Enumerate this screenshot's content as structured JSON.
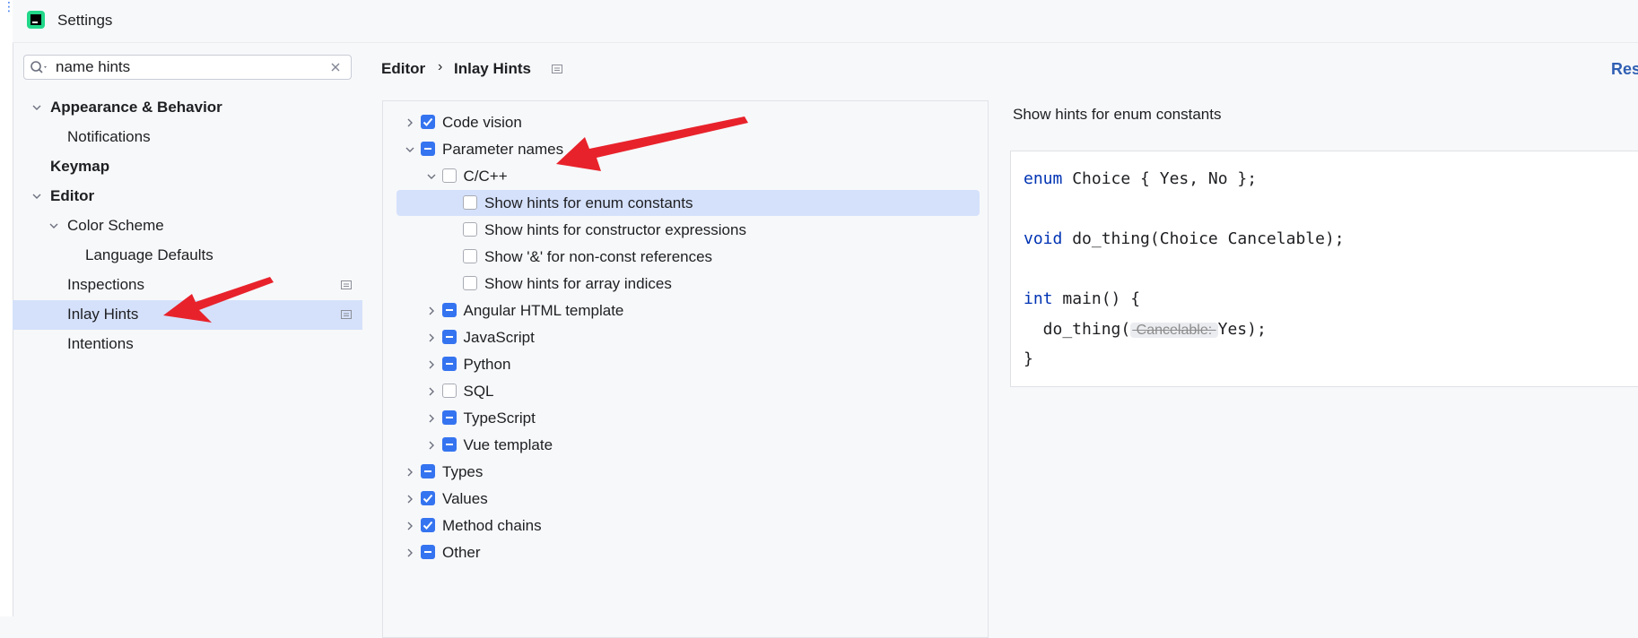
{
  "window": {
    "title": "Settings"
  },
  "search": {
    "value": "name hints",
    "placeholder": ""
  },
  "sidebar": {
    "items": [
      {
        "label": "Appearance & Behavior"
      },
      {
        "label": "Notifications"
      },
      {
        "label": "Keymap"
      },
      {
        "label": "Editor"
      },
      {
        "label": "Color Scheme"
      },
      {
        "label": "Language Defaults"
      },
      {
        "label": "Inspections"
      },
      {
        "label": "Inlay Hints"
      },
      {
        "label": "Intentions"
      }
    ]
  },
  "breadcrumb": {
    "parent": "Editor",
    "separator": "›",
    "current": "Inlay Hints"
  },
  "header": {
    "reset_label": "Res"
  },
  "options": {
    "items": [
      {
        "label": "Code vision",
        "state": "checked"
      },
      {
        "label": "Parameter names",
        "state": "partial"
      },
      {
        "label": "C/C++",
        "state": "unchecked"
      },
      {
        "label": "Show hints for enum constants",
        "state": "unchecked"
      },
      {
        "label": "Show hints for constructor expressions",
        "state": "unchecked"
      },
      {
        "label": "Show '&' for non-const references",
        "state": "unchecked"
      },
      {
        "label": "Show hints for array indices",
        "state": "unchecked"
      },
      {
        "label": "Angular HTML template",
        "state": "partial"
      },
      {
        "label": "JavaScript",
        "state": "partial"
      },
      {
        "label": "Python",
        "state": "partial"
      },
      {
        "label": "SQL",
        "state": "unchecked"
      },
      {
        "label": "TypeScript",
        "state": "partial"
      },
      {
        "label": "Vue template",
        "state": "partial"
      },
      {
        "label": "Types",
        "state": "partial"
      },
      {
        "label": "Values",
        "state": "checked"
      },
      {
        "label": "Method chains",
        "state": "checked"
      },
      {
        "label": "Other",
        "state": "partial"
      }
    ]
  },
  "preview": {
    "title": "Show hints for enum constants",
    "code": {
      "l1_kw": "enum",
      "l1_rest": " Choice { Yes, No };",
      "l2_kw": "void",
      "l2_rest": " do_thing(Choice Cancelable);",
      "l3_kw": "int",
      "l3_rest": " main() {",
      "l4_pre": "  do_thing(",
      "l4_hint": " Cancelable: ",
      "l4_post": "Yes);",
      "l5": "}"
    }
  },
  "colors": {
    "accent": "#3574f0",
    "selection": "#d5e1fb",
    "arrow": "#e8222b",
    "keyword": "#0033b3"
  },
  "icons": {
    "app": "jetbrains-app-icon",
    "search": "search-icon",
    "clear": "close-icon",
    "settings_badge": "project-scope-icon"
  }
}
